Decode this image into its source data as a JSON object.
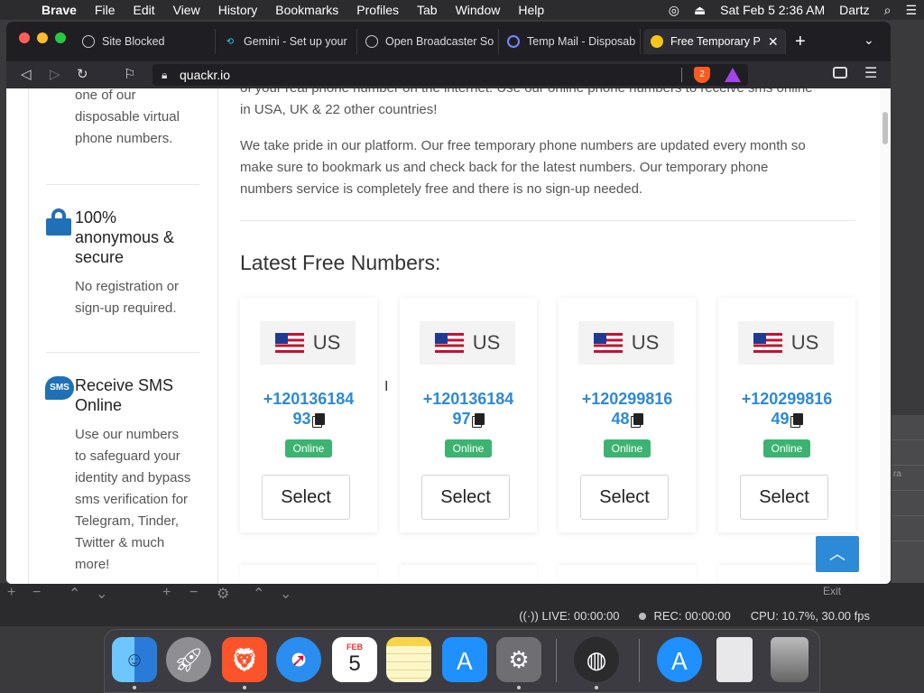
{
  "menubar": {
    "app": "Brave",
    "items": [
      "File",
      "Edit",
      "View",
      "History",
      "Bookmarks",
      "Profiles",
      "Tab",
      "Window",
      "Help"
    ],
    "datetime": "Sat Feb 5  2:36 AM",
    "user": "Dartz"
  },
  "browser": {
    "tabs": [
      {
        "title": "Site Blocked"
      },
      {
        "title": "Gemini - Set up your"
      },
      {
        "title": "Open Broadcaster So"
      },
      {
        "title": "Temp Mail - Disposab"
      },
      {
        "title": "Free Temporary P"
      }
    ],
    "url": "quackr.io",
    "shield_count": "2"
  },
  "sidebar": {
    "intro_lines": [
      "one of our",
      "disposable virtual",
      "phone numbers."
    ],
    "features": [
      {
        "title_lines": [
          "100%",
          "anonymous &",
          "secure"
        ],
        "text_lines": [
          "No registration or",
          "sign-up required."
        ]
      },
      {
        "icon_label": "SMS",
        "title_lines": [
          "Receive SMS",
          "Online"
        ],
        "text_lines": [
          "Use our numbers",
          "to safeguard your",
          "identity and bypass",
          "sms verification for",
          "Telegram, Tinder,",
          "Twitter & much",
          "more!"
        ]
      }
    ]
  },
  "content": {
    "para1_lines": [
      "of your real phone number on the internet. Use our online phone numbers to receive sms online",
      "in USA, UK & 22 other countries!"
    ],
    "para2_lines": [
      "We take pride in our platform. Our free temporary phone numbers are updated every month so",
      "make sure to bookmark us and check back for the latest numbers. Our temporary phone",
      "numbers service is completely free and there is no sign-up needed."
    ],
    "heading": "Latest Free Numbers:",
    "cards": [
      {
        "country": "US",
        "number_line1": "+120136184",
        "number_line2": "93",
        "status": "Online",
        "button": "Select"
      },
      {
        "country": "US",
        "number_line1": "+120136184",
        "number_line2": "97",
        "status": "Online",
        "button": "Select"
      },
      {
        "country": "US",
        "number_line1": "+120299816",
        "number_line2": "48",
        "status": "Online",
        "button": "Select"
      },
      {
        "country": "US",
        "number_line1": "+120299816",
        "number_line2": "49",
        "status": "Online",
        "button": "Select"
      }
    ]
  },
  "obs": {
    "live": "LIVE: 00:00:00",
    "rec": "REC: 00:00:00",
    "cpu": "CPU: 10.7%, 30.00 fps",
    "exit": "Exit",
    "side_text": "ra"
  },
  "dock": {
    "apps": [
      "Finder",
      "Launchpad",
      "Brave Browser",
      "Safari",
      "Calendar",
      "Notes",
      "App Store",
      "System Preferences",
      "OBS",
      "App Store Downloads",
      "Document",
      "Trash"
    ],
    "calendar_month": "FEB",
    "calendar_day": "5"
  },
  "colors": {
    "accent": "#2d8ad6",
    "online": "#3cb371"
  }
}
